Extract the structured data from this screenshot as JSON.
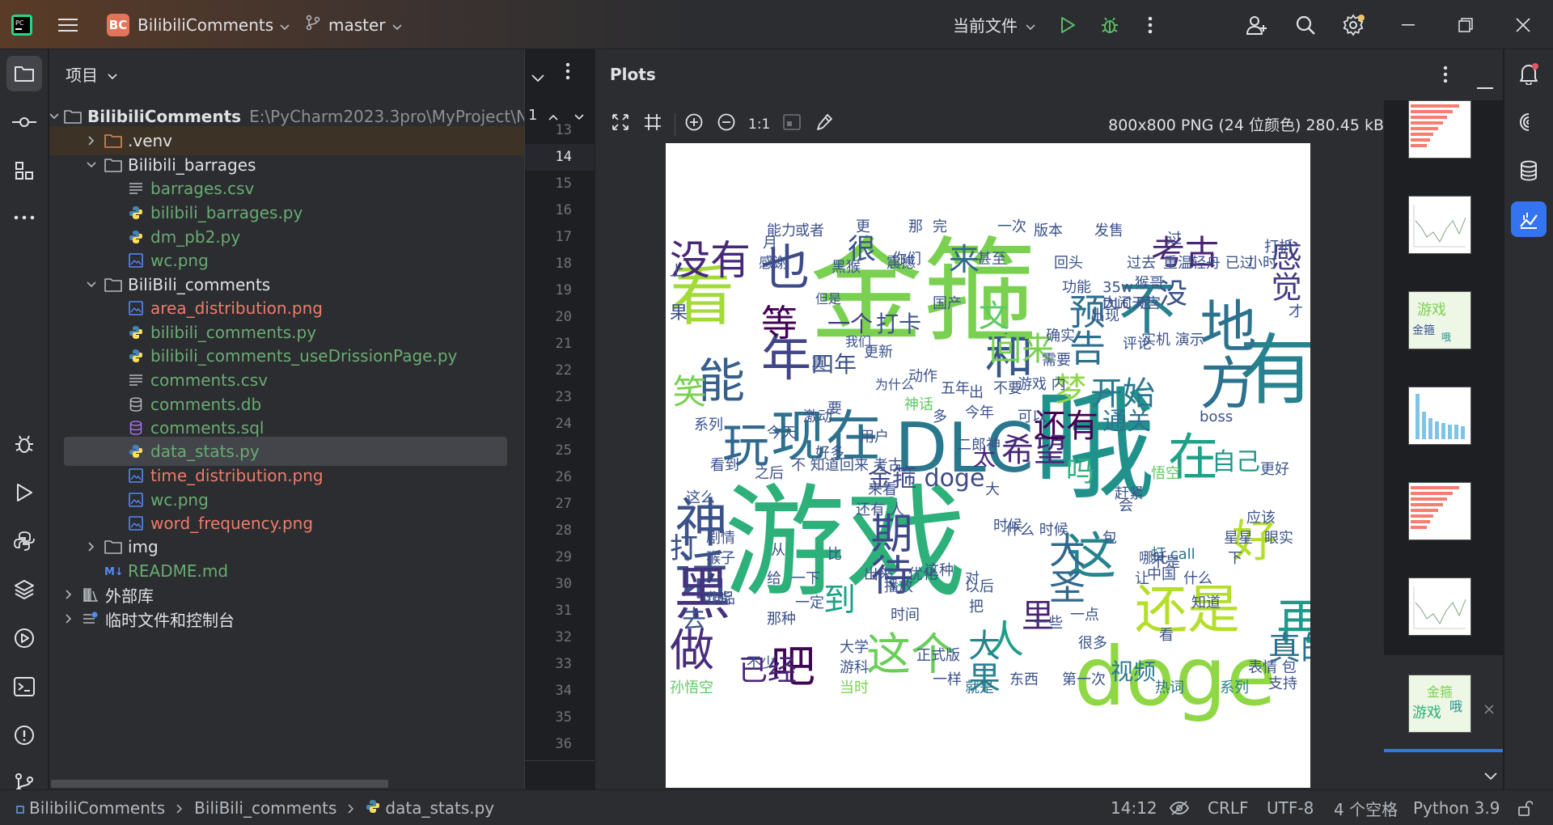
{
  "titlebar": {
    "project_badge": "BC",
    "project_name": "BilibiliComments",
    "branch": "master",
    "run_config": "当前文件"
  },
  "project_panel": {
    "title": "项目",
    "tree": [
      {
        "label": "BilibiliComments",
        "extra": "E:\\PyCharm2023.3pro\\MyProject\\Ne",
        "kind": "folder-open",
        "color": "white"
      },
      {
        "label": ".venv",
        "kind": "folder-closed-orange",
        "color": "white"
      },
      {
        "label": "Bilibili_barrages",
        "kind": "folder-open",
        "color": "white"
      },
      {
        "label": "barrages.csv",
        "kind": "text",
        "color": "green"
      },
      {
        "label": "bilibili_barrages.py",
        "kind": "python",
        "color": "green"
      },
      {
        "label": "dm_pb2.py",
        "kind": "python",
        "color": "green"
      },
      {
        "label": "wc.png",
        "kind": "image",
        "color": "green"
      },
      {
        "label": "BiliBili_comments",
        "kind": "folder-open",
        "color": "white"
      },
      {
        "label": "area_distribution.png",
        "kind": "image",
        "color": "red"
      },
      {
        "label": "bilibili_comments.py",
        "kind": "python",
        "color": "green"
      },
      {
        "label": "bilibili_comments_useDrissionPage.py",
        "kind": "python",
        "color": "green"
      },
      {
        "label": "comments.csv",
        "kind": "text",
        "color": "green"
      },
      {
        "label": "comments.db",
        "kind": "db",
        "color": "green"
      },
      {
        "label": "comments.sql",
        "kind": "sql",
        "color": "green"
      },
      {
        "label": "data_stats.py",
        "kind": "python",
        "color": "green"
      },
      {
        "label": "time_distribution.png",
        "kind": "image",
        "color": "red"
      },
      {
        "label": "wc.png",
        "kind": "image",
        "color": "green"
      },
      {
        "label": "word_frequency.png",
        "kind": "image",
        "color": "red"
      },
      {
        "label": "img",
        "kind": "folder-closed",
        "color": "white"
      },
      {
        "label": "README.md",
        "kind": "markdown",
        "color": "green"
      },
      {
        "label": "外部库",
        "kind": "library",
        "color": "white"
      },
      {
        "label": "临时文件和控制台",
        "kind": "scratch",
        "color": "white"
      }
    ]
  },
  "gutter": {
    "tab_index": "1",
    "line_numbers": [
      "13",
      "14",
      "15",
      "16",
      "17",
      "18",
      "19",
      "20",
      "21",
      "22",
      "23",
      "24",
      "25",
      "26",
      "27",
      "28",
      "29",
      "30",
      "31",
      "32",
      "33",
      "34",
      "35",
      "36"
    ]
  },
  "plots": {
    "title": "Plots",
    "zoom_actual": "1:1",
    "image_info": "800x800 PNG (24 位颜色) 280.45 kB"
  },
  "wordcloud": {
    "words": [
      {
        "t": "游戏",
        "c": "#2db07a"
      },
      {
        "t": "金箍",
        "c": "#7ad151"
      },
      {
        "t": "哦",
        "c": "#21918c"
      },
      {
        "t": "DLC",
        "c": "#2a788e"
      },
      {
        "t": "doge",
        "c": "#8fd744"
      },
      {
        "t": "有",
        "c": "#26828e"
      },
      {
        "t": "地方",
        "c": "#2c728e"
      },
      {
        "t": "神话",
        "c": "#3b528b"
      },
      {
        "t": "黑",
        "c": "#46337e"
      },
      {
        "t": "看",
        "c": "#a2da37"
      },
      {
        "t": "也",
        "c": "#3e4a89"
      },
      {
        "t": "年",
        "c": "#414487"
      },
      {
        "t": "能",
        "c": "#355f8d"
      },
      {
        "t": "现在",
        "c": "#2c728e"
      },
      {
        "t": "玩",
        "c": "#31688e"
      },
      {
        "t": "没有",
        "c": "#482878"
      },
      {
        "t": "和",
        "c": "#38588c"
      },
      {
        "t": "在",
        "c": "#1fa187"
      },
      {
        "t": "这",
        "c": "#25848e"
      },
      {
        "t": "还是",
        "c": "#b5de2b"
      },
      {
        "t": "再",
        "c": "#1f998a"
      },
      {
        "t": "好",
        "c": "#b5de2b"
      },
      {
        "t": "做",
        "c": "#472d7b"
      },
      {
        "t": "吧",
        "c": "#3e0751"
      },
      {
        "t": "这个",
        "c": "#6ccd5a"
      },
      {
        "t": "人",
        "c": "#1f9e89"
      },
      {
        "t": "里",
        "c": "#482475"
      },
      {
        "t": "真的",
        "c": "#2c728e"
      },
      {
        "t": "期待",
        "c": "#3e4989"
      },
      {
        "t": "大圣",
        "c": "#31688e"
      },
      {
        "t": "等",
        "c": "#440154"
      },
      {
        "t": "来",
        "c": "#31688e"
      },
      {
        "t": "文",
        "c": "#5ec962"
      },
      {
        "t": "不",
        "c": "#26828e"
      },
      {
        "t": "预告",
        "c": "#2e6e8e"
      },
      {
        "t": "考古",
        "c": "#482475"
      },
      {
        "t": "感觉",
        "c": "#443983"
      },
      {
        "t": "开始",
        "c": "#2a788e"
      },
      {
        "t": "梦",
        "c": "#8fd744"
      },
      {
        "t": "回来",
        "c": "#7ad151"
      },
      {
        "t": "希望",
        "c": "#482878"
      },
      {
        "t": "还有",
        "c": "#440154"
      },
      {
        "t": "通关",
        "c": "#2c728e"
      },
      {
        "t": "金箍 doge",
        "c": "#3e4a89"
      },
      {
        "t": "打卡",
        "c": "#3b528b"
      },
      {
        "t": "一个",
        "c": "#433e85"
      },
      {
        "t": "已经",
        "c": "#482475"
      },
      {
        "t": "视频",
        "c": "#2a788e"
      },
      {
        "t": "笑",
        "c": "#7ad151"
      },
      {
        "t": "自己",
        "c": "#1f968b"
      },
      {
        "t": "吗",
        "c": "#2db27d"
      },
      {
        "t": "很",
        "c": "#3b528b"
      },
      {
        "t": "没",
        "c": "#3b528b"
      },
      {
        "t": "到",
        "c": "#1fa187"
      },
      {
        "t": "大果",
        "c": "#25848e"
      },
      {
        "t": "太",
        "c": "#482878"
      },
      {
        "t": "五年",
        "c": "#3b528b"
      },
      {
        "t": "四年",
        "c": "#3b528b"
      },
      {
        "t": "神话",
        "c": "#5ec962"
      },
      {
        "t": "悟空",
        "c": "#5ec962"
      },
      {
        "t": "boss",
        "c": "#3b528b"
      },
      {
        "t": "打 call",
        "c": "#2c728e"
      },
      {
        "t": "热词",
        "c": "#2c728e"
      },
      {
        "t": "系列",
        "c": "#26828e"
      },
      {
        "t": "孙悟空",
        "c": "#5ec962"
      },
      {
        "t": "游科",
        "c": "#3b528b"
      },
      {
        "t": "当时",
        "c": "#7ad151"
      },
      {
        "t": "就是",
        "c": "#2c728e"
      },
      {
        "t": "东西",
        "c": "#3b528b"
      },
      {
        "t": "知道",
        "c": "#3b528b"
      },
      {
        "t": "什么",
        "c": "#3b528b"
      },
      {
        "t": "应该",
        "c": "#3b528b"
      },
      {
        "t": "星星",
        "c": "#3b528b"
      },
      {
        "t": "眼实",
        "c": "#3b528b"
      },
      {
        "t": "可能",
        "c": "#3b528b"
      },
      {
        "t": "一定",
        "c": "#3b528b"
      },
      {
        "t": "播放",
        "c": "#3b528b"
      },
      {
        "t": "时间",
        "c": "#3b528b"
      },
      {
        "t": "出来",
        "c": "#3b528b"
      },
      {
        "t": "优化",
        "c": "#3b528b"
      },
      {
        "t": "正式版",
        "c": "#3b528b"
      },
      {
        "t": "看到",
        "c": "#3b528b"
      },
      {
        "t": "剧情",
        "c": "#3b528b"
      },
      {
        "t": "猴子",
        "c": "#3b528b"
      },
      {
        "t": "作品",
        "c": "#3b528b"
      },
      {
        "t": "系列",
        "c": "#3b528b"
      },
      {
        "t": "好多",
        "c": "#3b528b"
      },
      {
        "t": "国产",
        "c": "#3b528b"
      },
      {
        "t": "用户",
        "c": "#3b528b"
      },
      {
        "t": "不是",
        "c": "#3b528b"
      },
      {
        "t": "中国",
        "c": "#3b528b"
      },
      {
        "t": "很多",
        "c": "#3b528b"
      },
      {
        "t": "一样",
        "c": "#3b528b"
      },
      {
        "t": "版本",
        "c": "#3b528b"
      },
      {
        "t": "发售",
        "c": "#3b528b"
      },
      {
        "t": "震撼",
        "c": "#3b528b"
      },
      {
        "t": "能力",
        "c": "#3b528b"
      },
      {
        "t": "或者",
        "c": "#3b528b"
      },
      {
        "t": "感谢",
        "c": "#3b528b"
      },
      {
        "t": "功能",
        "c": "#3b528b"
      },
      {
        "t": "过去",
        "c": "#3b528b"
      },
      {
        "t": "出现",
        "c": "#3b528b"
      },
      {
        "t": "评论",
        "c": "#3b528b"
      },
      {
        "t": "需要",
        "c": "#3b528b"
      },
      {
        "t": "今年",
        "c": "#3b528b"
      },
      {
        "t": "动作",
        "c": "#3b528b"
      },
      {
        "t": "猴哥",
        "c": "#3b528b"
      },
      {
        "t": "35w",
        "c": "#3b528b"
      },
      {
        "t": "DLC 呢",
        "c": "#3b528b"
      },
      {
        "t": "确实",
        "c": "#3b528b"
      },
      {
        "t": "大闹天宫",
        "c": "#3b528b"
      },
      {
        "t": "实机 演示",
        "c": "#3b528b"
      },
      {
        "t": "更好",
        "c": "#3b528b"
      },
      {
        "t": "让",
        "c": "#3b528b"
      },
      {
        "t": "会",
        "c": "#3b528b"
      },
      {
        "t": "月",
        "c": "#3b528b"
      },
      {
        "t": "上",
        "c": "#3b528b"
      },
      {
        "t": "更",
        "c": "#3b528b"
      },
      {
        "t": "那",
        "c": "#3b528b"
      },
      {
        "t": "过",
        "c": "#3b528b"
      },
      {
        "t": "打",
        "c": "#3b528b"
      },
      {
        "t": "果",
        "c": "#3b528b"
      },
      {
        "t": "要",
        "c": "#3b528b"
      },
      {
        "t": "真",
        "c": "#3b528b"
      },
      {
        "t": "比",
        "c": "#3b528b"
      },
      {
        "t": "从",
        "c": "#3b528b"
      },
      {
        "t": "看",
        "c": "#3b528b"
      },
      {
        "t": "下",
        "c": "#3b528b"
      },
      {
        "t": "把",
        "c": "#3b528b"
      },
      {
        "t": "多",
        "c": "#3b528b"
      },
      {
        "t": "大",
        "c": "#3b528b"
      },
      {
        "t": "出",
        "c": "#3b528b"
      },
      {
        "t": "才",
        "c": "#3b528b"
      },
      {
        "t": "对",
        "c": "#3b528b"
      },
      {
        "t": "去",
        "c": "#3b528b"
      },
      {
        "t": "给",
        "c": "#3b528b"
      },
      {
        "t": "一下",
        "c": "#3b528b"
      },
      {
        "t": "以后",
        "c": "#3b528b"
      },
      {
        "t": "一些",
        "c": "#3b528b"
      },
      {
        "t": "一点",
        "c": "#3b528b"
      },
      {
        "t": "不少",
        "c": "#3b528b"
      },
      {
        "t": "大学",
        "c": "#3b528b"
      },
      {
        "t": "那种",
        "c": "#3b528b"
      },
      {
        "t": "不 知道",
        "c": "#3b528b"
      },
      {
        "t": "回来 考古",
        "c": "#3b528b"
      },
      {
        "t": "来看",
        "c": "#3b528b"
      },
      {
        "t": "还有 人",
        "c": "#3b528b"
      },
      {
        "t": "这么",
        "c": "#3b528b"
      },
      {
        "t": "之后",
        "c": "#3b528b"
      },
      {
        "t": "激动",
        "c": "#3b528b"
      },
      {
        "t": "今天",
        "c": "#3b528b"
      },
      {
        "t": "黑猴",
        "c": "#3b528b"
      },
      {
        "t": "你们",
        "c": "#3b528b"
      },
      {
        "t": "回头",
        "c": "#3b528b"
      },
      {
        "t": "甚至",
        "c": "#3b528b"
      },
      {
        "t": "完",
        "c": "#3b528b"
      },
      {
        "t": "重温",
        "c": "#3b528b"
      },
      {
        "t": "小时",
        "c": "#3b528b"
      },
      {
        "t": "可以",
        "c": "#3b528b"
      },
      {
        "t": "游戏 内",
        "c": "#3b528b"
      },
      {
        "t": "不要",
        "c": "#3b528b"
      },
      {
        "t": "时候",
        "c": "#3b528b"
      },
      {
        "t": "什么 时候",
        "c": "#3b528b"
      },
      {
        "t": "包",
        "c": "#3b528b"
      },
      {
        "t": "哪吒",
        "c": "#3b528b"
      },
      {
        "t": "赶紧",
        "c": "#3b528b"
      },
      {
        "t": "第一次",
        "c": "#3b528b"
      },
      {
        "t": "支持",
        "c": "#3b528b"
      },
      {
        "t": "表情 包",
        "c": "#3b528b"
      },
      {
        "t": "轻舟 已过",
        "c": "#3b528b"
      },
      {
        "t": "打折",
        "c": "#3b528b"
      },
      {
        "t": "更新",
        "c": "#3b528b"
      },
      {
        "t": "二郎神",
        "c": "#3b528b"
      },
      {
        "t": "一次",
        "c": "#3b528b"
      },
      {
        "t": "这种",
        "c": "#3b528b"
      },
      {
        "t": "但是",
        "c": "#3b528b"
      },
      {
        "t": "我们",
        "c": "#3b528b"
      },
      {
        "t": "为什么",
        "c": "#3b528b"
      }
    ]
  },
  "status": {
    "crumb_project": "BilibiliComments",
    "crumb_folder": "BiliBili_comments",
    "crumb_file": "data_stats.py",
    "position": "14:12",
    "line_sep": "CRLF",
    "encoding": "UTF-8",
    "indent": "4 个空格",
    "interpreter": "Python 3.9"
  },
  "colors": {
    "accent": "#3574f0",
    "run_green": "#5fb865",
    "vcs_green": "#6aab73",
    "unversioned_red": "#f07b6a",
    "notification_badge": "#e55765"
  }
}
